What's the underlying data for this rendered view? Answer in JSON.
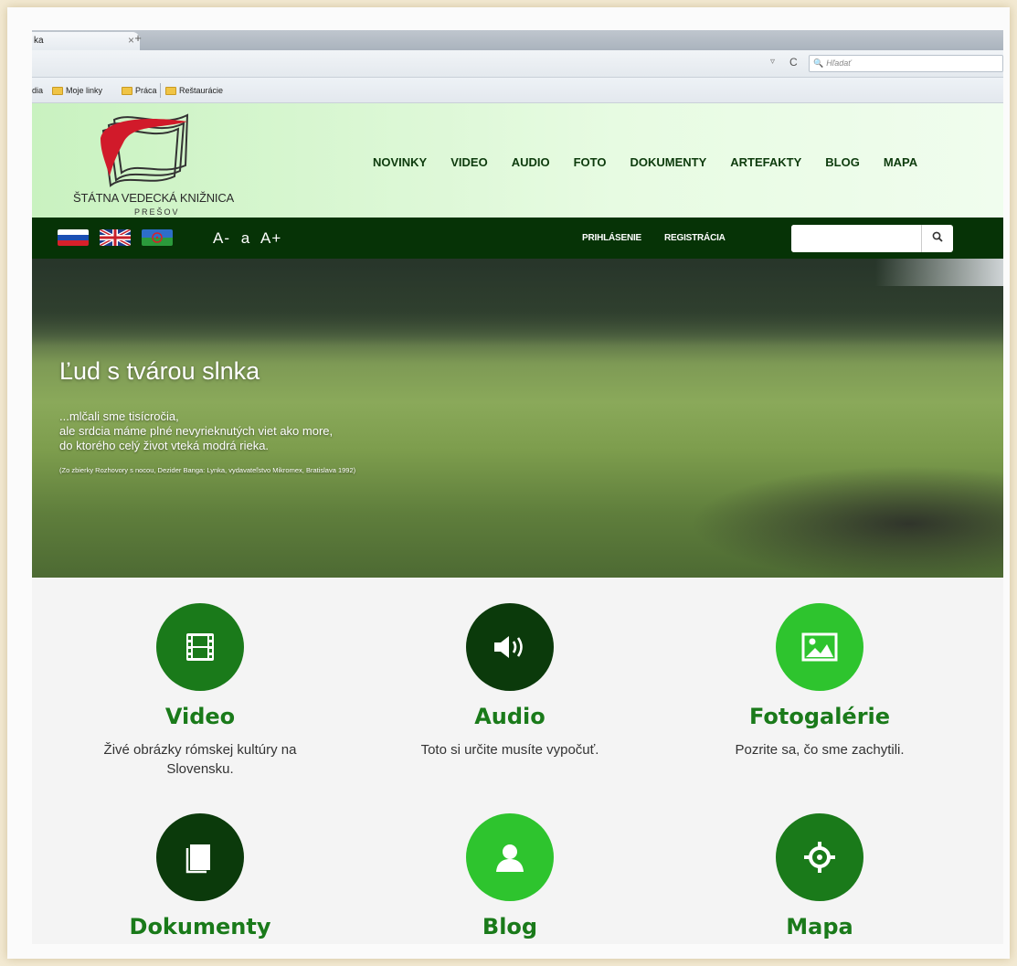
{
  "browser": {
    "tab_title": "ka",
    "tab_close": "×",
    "new_tab": "+",
    "reload_icon": "C",
    "search_placeholder": "Hľadať",
    "bookmarks": [
      "dia",
      "Moje linky",
      "Práca",
      "Reštaurácie"
    ]
  },
  "site": {
    "logo_text": "ŠTÁTNA VEDECKÁ KNIŽNICA",
    "logo_sub": "PREŠOV",
    "nav": [
      "NOVINKY",
      "VIDEO",
      "AUDIO",
      "FOTO",
      "DOKUMENTY",
      "ARTEFAKTY",
      "BLOG",
      "MAPA"
    ],
    "font_controls": [
      "A-",
      "a",
      "A+"
    ],
    "login": "PRIHLÁSENIE",
    "register": "REGISTRÁCIA",
    "search_icon": "magnifier-icon"
  },
  "hero": {
    "title": "Ľud s tvárou slnka",
    "poem": [
      "...mlčali sme tisícročia,",
      "ale srdcia máme plné nevyrieknutých viet ako more,",
      "do ktorého celý život vteká modrá rieka."
    ],
    "source": "(Zo zbierky Rozhovory s nocou, Dezider Banga: Lynka, vydavateľstvo Mikromex, Bratislava 1992)"
  },
  "features": [
    {
      "title": "Video",
      "desc_lines": [
        "Živé obrázky rómskej kultúry na",
        "Slovensku."
      ],
      "icon": "film-icon",
      "color": "#1a7a1a"
    },
    {
      "title": "Audio",
      "desc_lines": [
        "Toto si určite musíte vypočuť."
      ],
      "icon": "speaker-icon",
      "color": "#0b3a0b"
    },
    {
      "title": "Fotogalérie",
      "desc_lines": [
        "Pozrite sa, čo sme zachytili."
      ],
      "icon": "picture-icon",
      "color": "#2ec42e"
    },
    {
      "title": "Dokumenty",
      "desc_lines": [],
      "icon": "document-icon",
      "color": "#0b3a0b"
    },
    {
      "title": "Blog",
      "desc_lines": [],
      "icon": "user-icon",
      "color": "#2ec42e"
    },
    {
      "title": "Mapa",
      "desc_lines": [],
      "icon": "crosshair-icon",
      "color": "#1a7a1a"
    }
  ]
}
